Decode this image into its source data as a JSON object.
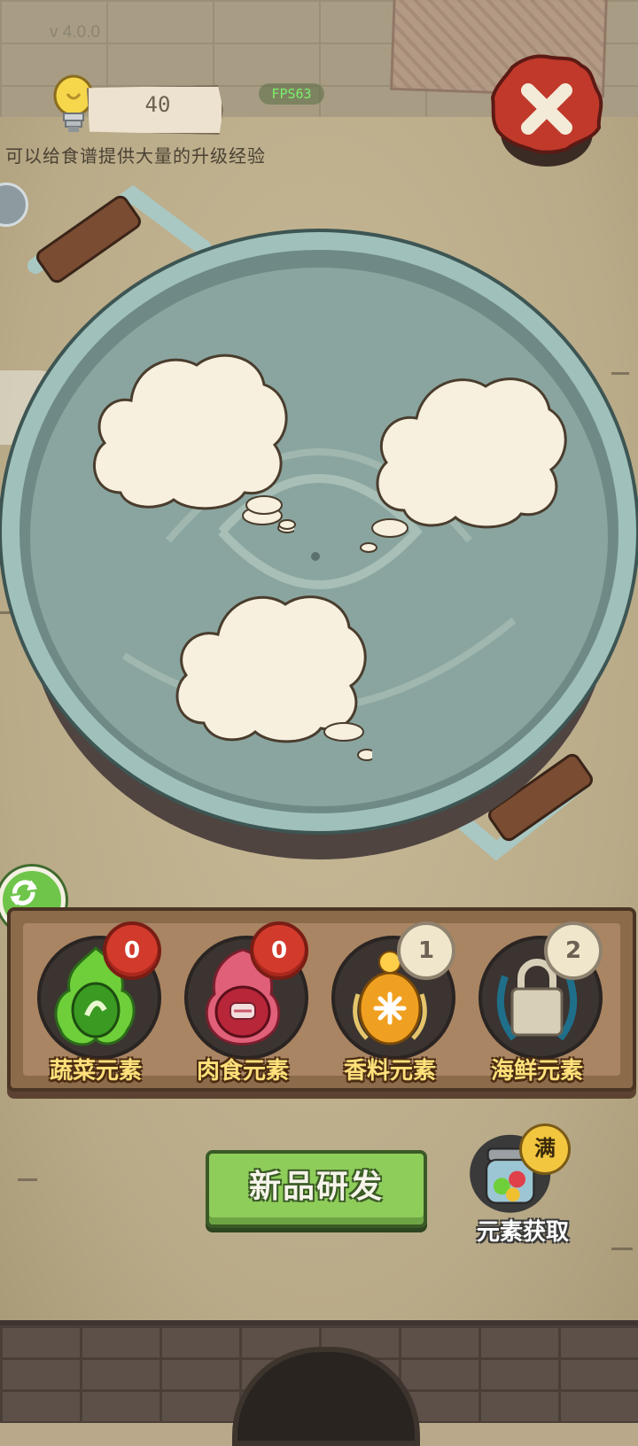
{
  "header": {
    "version": "v  4.0.0",
    "score": "40",
    "fps": "FPS63",
    "hint": "可以给食谱提供大量的升级经验"
  },
  "pot": {
    "bubbles": [
      {
        "label": ""
      },
      {
        "label": ""
      },
      {
        "label": ""
      }
    ]
  },
  "elements": [
    {
      "label": "蔬菜元素",
      "count": "0",
      "icon": "vegetable-element-icon",
      "color": "#6fcf3a"
    },
    {
      "label": "肉食元素",
      "count": "0",
      "icon": "meat-element-icon",
      "color": "#d24a5a"
    },
    {
      "label": "香料元素",
      "count": "1",
      "icon": "spice-element-icon",
      "color": "#f0a020"
    },
    {
      "label": "海鲜元素",
      "count": "2",
      "icon": "lock-icon",
      "color": "#1f6f8a"
    }
  ],
  "actions": {
    "research_label": "新品研发",
    "acquire_label": "元素获取",
    "full_badge": "满"
  },
  "colors": {
    "accent_green": "#8fcd5b",
    "badge_red": "#d23a2c",
    "label_yellow": "#ffe07a"
  }
}
